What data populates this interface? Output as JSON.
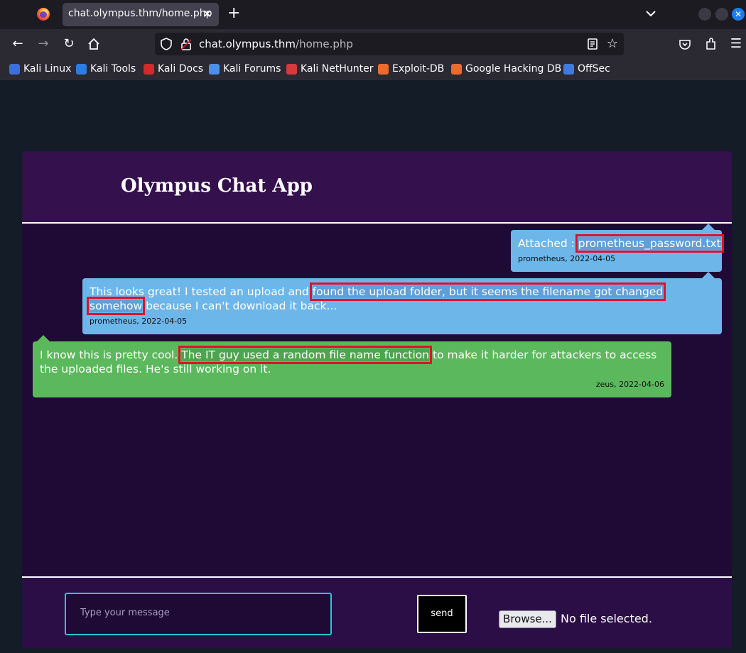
{
  "browser": {
    "tab_title": "chat.olympus.thm/home.php",
    "tab_close": "✕",
    "new_tab": "+",
    "url_host": "chat.olympus.thm",
    "url_path": "/home.php",
    "bookmarks": [
      {
        "label": "Kali Linux",
        "color": "#3c6fd8"
      },
      {
        "label": "Kali Tools",
        "color": "#2d7de0"
      },
      {
        "label": "Kali Docs",
        "color": "#d12b2b"
      },
      {
        "label": "Kali Forums",
        "color": "#4a8fe8"
      },
      {
        "label": "Kali NetHunter",
        "color": "#d63a3a"
      },
      {
        "label": "Exploit-DB",
        "color": "#ec6a2b"
      },
      {
        "label": "Google Hacking DB",
        "color": "#ec6a2b"
      },
      {
        "label": "OffSec",
        "color": "#3d7be0"
      }
    ]
  },
  "app": {
    "title": "Olympus Chat App",
    "messages": [
      {
        "prefix": "Attached : ",
        "highlight": "prometheus_password.txt",
        "suffix": "",
        "meta": "prometheus, 2022-04-05",
        "color": "#6cb6ea"
      },
      {
        "prefix": "This looks great! I tested an upload and ",
        "highlight": "found the upload folder, but it seems the filename got changed somehow",
        "suffix": " because I can't download it back...",
        "meta": "prometheus, 2022-04-05",
        "color": "#6cb6ea"
      },
      {
        "prefix": "I know this is pretty cool. ",
        "highlight": "The IT guy used a random file name function",
        "suffix": " to make it harder for attackers to access the uploaded files. He's still working on it.",
        "meta": "zeus, 2022-04-06",
        "color": "#5cb85c"
      }
    ],
    "input_placeholder": "Type your message",
    "send_label": "send",
    "browse_label": "Browse...",
    "file_status": "No file selected."
  },
  "colors": {
    "page_bg": "#131c27",
    "header_bg": "#34104c",
    "chat_bg": "#1f0a35",
    "highlight_box": "#e0102a",
    "input_border": "#27c6d6"
  }
}
